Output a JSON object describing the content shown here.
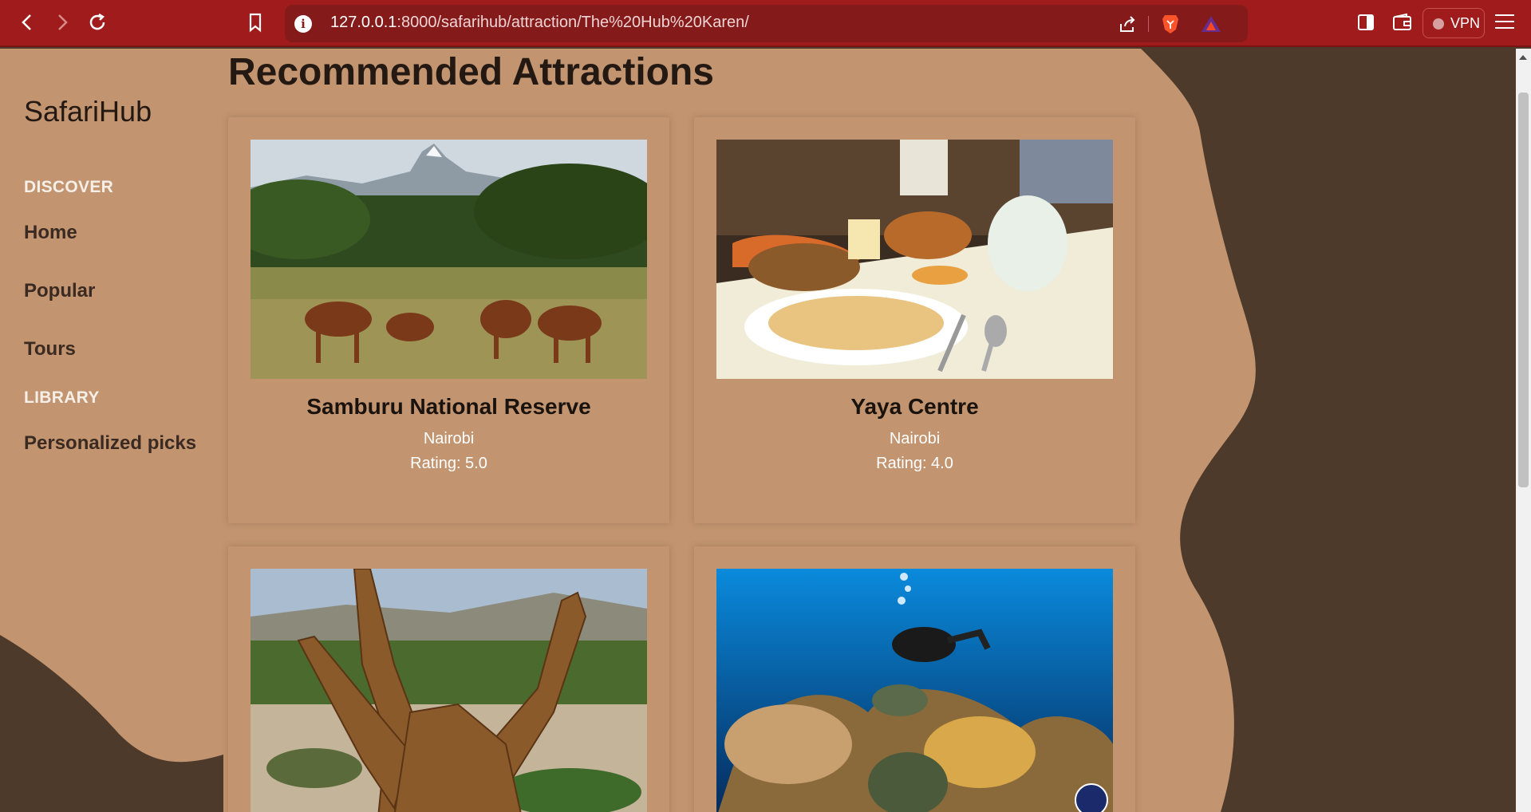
{
  "browser": {
    "url_host": "127.0.0.1",
    "url_path": ":8000/safarihub/attraction/The%20Hub%20Karen/",
    "vpn_label": "VPN",
    "icons": [
      "back-icon",
      "forward-icon",
      "reload-icon",
      "bookmark-icon",
      "info-icon",
      "share-icon",
      "brave-icon",
      "bat-icon",
      "sidebar-icon",
      "wallet-icon",
      "menu-icon"
    ]
  },
  "sidebar": {
    "brand": "SafariHub",
    "sections": [
      {
        "title": "DISCOVER",
        "items": [
          "Home",
          "Popular",
          "Tours"
        ]
      },
      {
        "title": "LIBRARY",
        "items": [
          "Personalized picks"
        ]
      }
    ]
  },
  "main": {
    "heading": "Recommended Attractions",
    "cards": [
      {
        "name": "Samburu National Reserve",
        "city": "Nairobi",
        "rating": "Rating: 5.0",
        "image": "antelope-savanna-photo"
      },
      {
        "name": "Yaya Centre",
        "city": "Nairobi",
        "rating": "Rating: 4.0",
        "image": "restaurant-dish-photo"
      },
      {
        "name": "",
        "city": "",
        "rating": "",
        "image": "giraffes-photo"
      },
      {
        "name": "",
        "city": "",
        "rating": "",
        "image": "scuba-diver-turtle-photo"
      }
    ]
  },
  "colors": {
    "chrome": "#a01c1c",
    "urlbar": "#841a1a",
    "page_tan": "#c29570",
    "page_brown": "#4e3a2a"
  }
}
